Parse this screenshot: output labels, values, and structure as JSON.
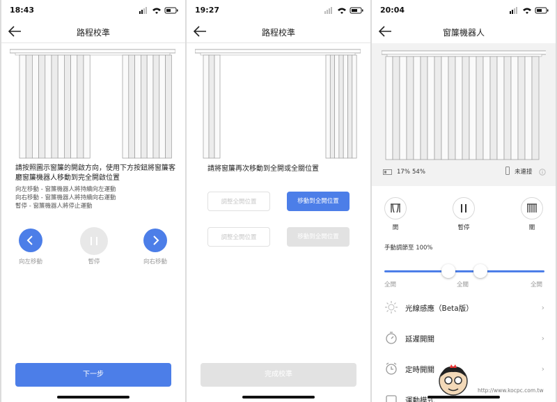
{
  "screen1": {
    "status_time": "18:43",
    "title": "路程校準",
    "instruction": "請按照圖示窗簾的開啟方向，使用下方按鈕將窗簾客廳窗簾機器人移動到完全開啟位置",
    "notes": [
      "向左移動 - 窗簾機器人將持續向左運動",
      "向右移動 - 窗簾機器人將持續向右運動",
      "暫停 - 窗簾機器人將停止運動"
    ],
    "left_label": "向左移動",
    "pause_label": "暫停",
    "right_label": "向右移動",
    "next_button": "下一步"
  },
  "screen2": {
    "status_time": "19:27",
    "title": "路程校準",
    "instruction": "請將窗簾再次移動到全開或全關位置",
    "adjust_open_1": "調整全開位置",
    "move_to_open": "移動到全開位置",
    "adjust_open_2": "調整全開位置",
    "move_to_open_2": "移動到全開位置",
    "finish_button": "完成校準"
  },
  "screen3": {
    "status_time": "20:04",
    "title": "窗簾機器人",
    "battery_pct": "17%",
    "position_pct": "54%",
    "connection": "未連接",
    "open_label": "開",
    "pause_label": "暫停",
    "close_label": "關",
    "manual_label": "手動調節至 100%",
    "slider_labels": [
      "全開",
      "全關",
      "全開"
    ],
    "slider_left_value": 0.4,
    "slider_right_value": 0.6,
    "rows": [
      "光線感應（Beta版）",
      "延遲開關",
      "定時開關",
      "運動模式"
    ]
  },
  "colors": {
    "accent": "#4c7ee8",
    "disabled": "#e2e2e2",
    "pause_grey": "#e8e8e8"
  },
  "watermark": {
    "text": "電腦王阿達",
    "url": "http://www.kocpc.com.tw"
  }
}
